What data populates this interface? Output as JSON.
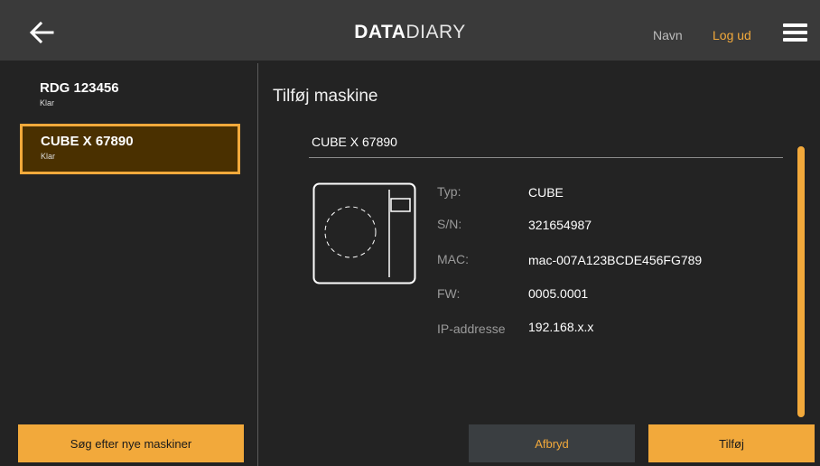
{
  "header": {
    "logo_bold": "DATA",
    "logo_light": "DIARY",
    "user_name": "Navn",
    "logout_label": "Log ud"
  },
  "sidebar": {
    "machines": [
      {
        "name": "RDG 123456",
        "status": "Klar"
      },
      {
        "name": "CUBE X 67890",
        "status": "Klar",
        "selected": true
      }
    ],
    "search_button": "Søg efter nye maskiner"
  },
  "main": {
    "title": "Tilføj maskine",
    "machine_name": "CUBE X 67890",
    "specs": [
      {
        "label": "Typ:",
        "value": "CUBE"
      },
      {
        "label": "S/N:",
        "value": "321654987"
      },
      {
        "label": "MAC:",
        "value": "mac-007A123BCDE456FG789"
      },
      {
        "label": "FW:",
        "value": "0005.0001"
      },
      {
        "label": "IP-addresse",
        "value": "192.168.x.x"
      }
    ],
    "cancel_button": "Afbryd",
    "add_button": "Tilføj"
  },
  "colors": {
    "accent": "#f2a93b",
    "background": "#232323",
    "header": "#3a3a3a",
    "selected_bg": "#4a3000"
  },
  "icons": [
    "back-arrow-icon",
    "hamburger-menu-icon",
    "washing-machine-icon"
  ]
}
